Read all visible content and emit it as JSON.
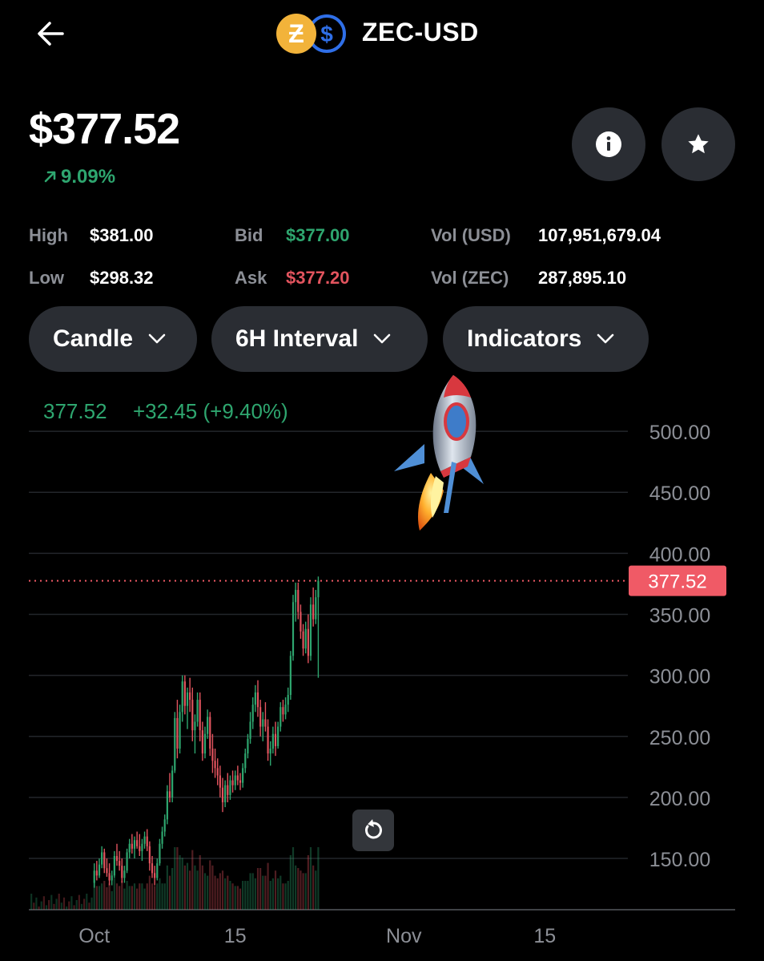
{
  "header": {
    "pair": "ZEC-USD"
  },
  "summary": {
    "price": "$377.52",
    "change": "9.09%"
  },
  "stats": {
    "high_label": "High",
    "high": "$381.00",
    "low_label": "Low",
    "low": "$298.32",
    "bid_label": "Bid",
    "bid": "$377.00",
    "ask_label": "Ask",
    "ask": "$377.20",
    "vol_usd_label": "Vol (USD)",
    "vol_usd": "107,951,679.04",
    "vol_zec_label": "Vol (ZEC)",
    "vol_zec": "287,895.10"
  },
  "controls": {
    "chart_type": "Candle",
    "interval": "6H Interval",
    "indicators": "Indicators"
  },
  "icons": {
    "back": "arrow-left-icon",
    "info": "info-icon",
    "star": "star-icon",
    "reset": "refresh-icon",
    "dropdown": "chevron-down-icon"
  },
  "colors": {
    "up": "#2ea66f",
    "down": "#e2545e",
    "background": "#000000",
    "surface": "#2a2d33",
    "price_tag": "#f05a66"
  },
  "chart_data": {
    "type": "candlestick",
    "header_value": "377.52",
    "header_change": "+32.45 (+9.40%)",
    "last_price_label": "377.52",
    "last_price": 377.52,
    "y_ticks": [
      500,
      450,
      400,
      350,
      300,
      250,
      200,
      150
    ],
    "y_tick_labels": [
      "500.00",
      "450.00",
      "400.00",
      "350.00",
      "300.00",
      "250.00",
      "200.00",
      "150.00"
    ],
    "ylim": [
      108,
      525
    ],
    "x_ticks": [
      "Oct",
      "15",
      "Nov",
      "15"
    ],
    "x_tick_index": [
      0,
      56,
      123,
      179
    ],
    "x_domain": [
      -26,
      212
    ],
    "grid": true,
    "candles": [
      [
        130,
        146,
        126,
        140
      ],
      [
        140,
        148,
        132,
        136
      ],
      [
        136,
        150,
        134,
        145
      ],
      [
        145,
        160,
        142,
        155
      ],
      [
        155,
        158,
        138,
        142
      ],
      [
        142,
        150,
        135,
        138
      ],
      [
        138,
        146,
        128,
        132
      ],
      [
        132,
        140,
        128,
        136
      ],
      [
        136,
        156,
        134,
        152
      ],
      [
        152,
        162,
        144,
        148
      ],
      [
        148,
        156,
        140,
        144
      ],
      [
        144,
        150,
        130,
        134
      ],
      [
        134,
        144,
        130,
        140
      ],
      [
        140,
        158,
        138,
        155
      ],
      [
        155,
        166,
        150,
        162
      ],
      [
        162,
        170,
        154,
        158
      ],
      [
        158,
        168,
        150,
        165
      ],
      [
        165,
        172,
        158,
        160
      ],
      [
        160,
        170,
        152,
        156
      ],
      [
        156,
        166,
        148,
        162
      ],
      [
        162,
        172,
        158,
        168
      ],
      [
        168,
        174,
        156,
        160
      ],
      [
        160,
        164,
        140,
        146
      ],
      [
        146,
        152,
        134,
        138
      ],
      [
        138,
        144,
        128,
        134
      ],
      [
        134,
        150,
        132,
        146
      ],
      [
        146,
        166,
        144,
        162
      ],
      [
        162,
        176,
        158,
        172
      ],
      [
        172,
        186,
        168,
        182
      ],
      [
        182,
        210,
        178,
        205
      ],
      [
        205,
        220,
        196,
        200
      ],
      [
        200,
        226,
        196,
        222
      ],
      [
        222,
        270,
        220,
        265
      ],
      [
        265,
        280,
        232,
        240
      ],
      [
        240,
        276,
        236,
        270
      ],
      [
        270,
        300,
        262,
        295
      ],
      [
        295,
        300,
        268,
        275
      ],
      [
        275,
        290,
        256,
        286
      ],
      [
        286,
        298,
        270,
        280
      ],
      [
        280,
        290,
        246,
        255
      ],
      [
        255,
        268,
        236,
        262
      ],
      [
        262,
        286,
        258,
        280
      ],
      [
        280,
        286,
        246,
        255
      ],
      [
        255,
        262,
        230,
        236
      ],
      [
        236,
        258,
        232,
        252
      ],
      [
        252,
        272,
        248,
        266
      ],
      [
        266,
        270,
        234,
        240
      ],
      [
        240,
        252,
        220,
        230
      ],
      [
        230,
        240,
        216,
        224
      ],
      [
        224,
        232,
        210,
        218
      ],
      [
        218,
        226,
        200,
        208
      ],
      [
        208,
        216,
        188,
        196
      ],
      [
        196,
        214,
        192,
        210
      ],
      [
        210,
        220,
        196,
        202
      ],
      [
        202,
        218,
        198,
        214
      ],
      [
        214,
        222,
        204,
        210
      ],
      [
        210,
        222,
        206,
        218
      ],
      [
        218,
        226,
        210,
        214
      ],
      [
        214,
        220,
        206,
        212
      ],
      [
        212,
        228,
        208,
        224
      ],
      [
        224,
        240,
        220,
        236
      ],
      [
        236,
        252,
        232,
        248
      ],
      [
        248,
        270,
        244,
        262
      ],
      [
        262,
        282,
        256,
        276
      ],
      [
        276,
        292,
        270,
        286
      ],
      [
        286,
        296,
        266,
        274
      ],
      [
        274,
        280,
        250,
        258
      ],
      [
        258,
        270,
        246,
        264
      ],
      [
        264,
        278,
        254,
        258
      ],
      [
        258,
        264,
        230,
        236
      ],
      [
        236,
        246,
        226,
        240
      ],
      [
        240,
        258,
        236,
        252
      ],
      [
        252,
        262,
        234,
        242
      ],
      [
        242,
        262,
        240,
        258
      ],
      [
        258,
        278,
        254,
        274
      ],
      [
        274,
        280,
        262,
        268
      ],
      [
        268,
        282,
        264,
        276
      ],
      [
        276,
        290,
        270,
        284
      ],
      [
        284,
        320,
        280,
        316
      ],
      [
        316,
        366,
        312,
        360
      ],
      [
        360,
        376,
        344,
        370
      ],
      [
        370,
        376,
        346,
        352
      ],
      [
        352,
        358,
        330,
        336
      ],
      [
        336,
        342,
        316,
        322
      ],
      [
        322,
        344,
        318,
        338
      ],
      [
        338,
        350,
        310,
        316
      ],
      [
        316,
        364,
        312,
        358
      ],
      [
        358,
        372,
        340,
        346
      ],
      [
        346,
        370,
        342,
        364
      ],
      [
        364,
        381,
        298,
        377.52
      ]
    ]
  }
}
